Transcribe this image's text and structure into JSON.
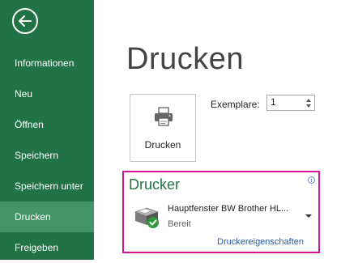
{
  "sidebar": {
    "back_icon": "back-arrow-icon",
    "items": [
      {
        "label": "Informationen",
        "active": false
      },
      {
        "label": "Neu",
        "active": false
      },
      {
        "label": "Öffnen",
        "active": false
      },
      {
        "label": "Speichern",
        "active": false
      },
      {
        "label": "Speichern unter",
        "active": false
      },
      {
        "label": "Drucken",
        "active": true
      },
      {
        "label": "Freigeben",
        "active": false
      }
    ]
  },
  "main": {
    "title": "Drucken",
    "print_button": {
      "label": "Drucken",
      "icon": "printer-icon"
    },
    "copies": {
      "label": "Exemplare:",
      "value": "1"
    },
    "printer": {
      "section_title": "Drucker",
      "info_icon": "info-icon",
      "selected_name": "Hauptfenster BW Brother HL...",
      "status": "Bereit",
      "icon": "printer-ready-icon",
      "properties_link": "Druckereigenschaften"
    }
  },
  "colors": {
    "sidebar_bg": "#217346",
    "sidebar_active": "#439467",
    "accent": "#217346",
    "highlight_border": "#d6139a",
    "link": "#2a57a6"
  }
}
